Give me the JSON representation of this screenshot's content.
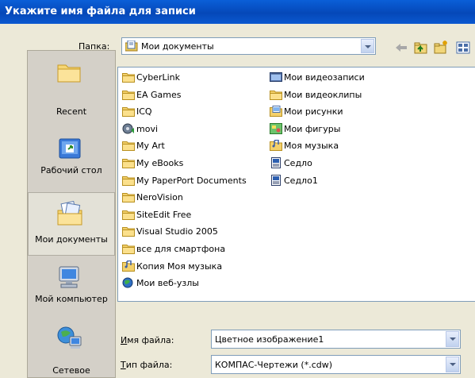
{
  "dialog": {
    "title": "Укажите имя файла для записи"
  },
  "folder": {
    "label_u": "П",
    "label_rest": "апка:",
    "value": "Мои документы"
  },
  "places": [
    {
      "label": "Recent",
      "icon": "recent-folder-icon"
    },
    {
      "label": "Рабочий стол",
      "icon": "desktop-icon"
    },
    {
      "label": "Мои документы",
      "icon": "my-documents-icon"
    },
    {
      "label": "Мой компьютер",
      "icon": "my-computer-icon"
    },
    {
      "label": "Сетевое",
      "icon": "network-icon"
    }
  ],
  "files_col1": [
    {
      "name": "CyberLink",
      "icon": "folder-icon"
    },
    {
      "name": "EA Games",
      "icon": "folder-icon"
    },
    {
      "name": "ICQ",
      "icon": "folder-icon"
    },
    {
      "name": "movi",
      "icon": "media-file-icon"
    },
    {
      "name": "My Art",
      "icon": "folder-icon"
    },
    {
      "name": "My eBooks",
      "icon": "folder-icon"
    },
    {
      "name": "My PaperPort Documents",
      "icon": "folder-icon"
    },
    {
      "name": "NeroVision",
      "icon": "folder-icon"
    },
    {
      "name": "SiteEdit Free",
      "icon": "folder-icon"
    },
    {
      "name": "Visual Studio 2005",
      "icon": "folder-icon"
    },
    {
      "name": "все для смартфона",
      "icon": "folder-icon"
    },
    {
      "name": "Копия Моя музыка",
      "icon": "music-folder-icon"
    },
    {
      "name": "Мои веб-узлы",
      "icon": "web-folder-icon"
    }
  ],
  "files_col2": [
    {
      "name": "Мои видеозаписи",
      "icon": "video-folder-icon"
    },
    {
      "name": "Мои видеоклипы",
      "icon": "folder-icon"
    },
    {
      "name": "Мои рисунки",
      "icon": "pictures-folder-icon"
    },
    {
      "name": "Мои фигуры",
      "icon": "shapes-folder-icon"
    },
    {
      "name": "Моя музыка",
      "icon": "music-folder-icon"
    },
    {
      "name": "Седло",
      "icon": "kompas-document-icon"
    },
    {
      "name": "Седло1",
      "icon": "kompas-document-icon"
    }
  ],
  "filename": {
    "label_u": "И",
    "label_rest": "мя файла:",
    "value": "Цветное изображение1"
  },
  "filetype": {
    "label_u": "Т",
    "label_rest": "ип файла:",
    "value": "КОМПАС-Чертежи (*.cdw)"
  }
}
